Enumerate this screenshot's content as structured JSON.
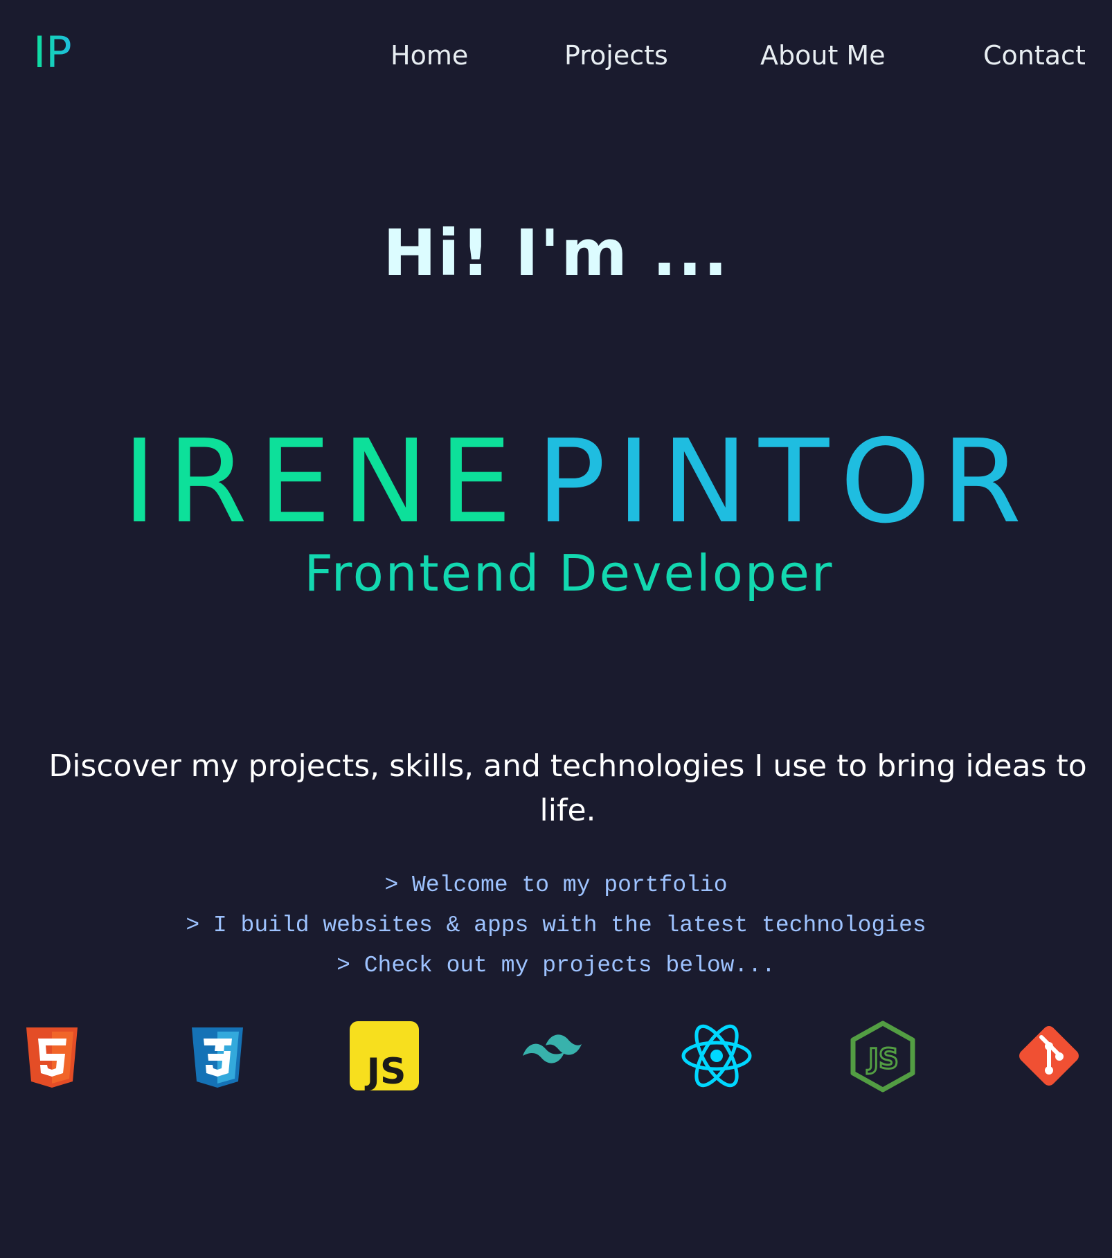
{
  "brand": {
    "logo_text": "IP",
    "accent_green": "#0de09a",
    "accent_blue": "#1fbde0"
  },
  "nav": {
    "items": [
      {
        "label": "Home"
      },
      {
        "label": "Projects"
      },
      {
        "label": "About Me"
      },
      {
        "label": "Contact"
      }
    ]
  },
  "hero": {
    "greeting": "Hi! I'm ...",
    "first_name": "IRENE",
    "last_name": "PINTOR",
    "role": "Frontend Developer",
    "tagline": "Discover my projects, skills, and technologies I use to bring ideas to life."
  },
  "terminal": {
    "lines": [
      "> Welcome to my portfolio",
      "> I build websites & apps with the latest technologies",
      "> Check out my projects below..."
    ]
  },
  "technologies": [
    {
      "icon": "html5-icon",
      "color": "#e44d26"
    },
    {
      "icon": "css3-icon",
      "color": "#1572b6"
    },
    {
      "icon": "javascript-icon",
      "label": "JS",
      "color": "#f7df1e"
    },
    {
      "icon": "tailwind-icon",
      "color": "#38b2ac"
    },
    {
      "icon": "react-icon",
      "color": "#00d8ff"
    },
    {
      "icon": "nodejs-icon",
      "label": "JS",
      "color": "#539e43"
    },
    {
      "icon": "git-icon",
      "color": "#f05033"
    }
  ]
}
